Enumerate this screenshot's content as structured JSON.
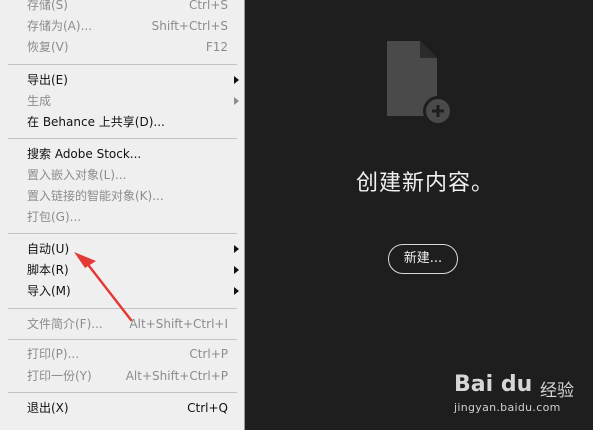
{
  "menu": {
    "items": [
      {
        "label": "存储(S)",
        "shortcut": "Ctrl+S",
        "disabled": true,
        "submenu": false
      },
      {
        "label": "存储为(A)...",
        "shortcut": "Shift+Ctrl+S",
        "disabled": true,
        "submenu": false
      },
      {
        "label": "恢复(V)",
        "shortcut": "F12",
        "disabled": true,
        "submenu": false
      },
      {
        "label": "导出(E)",
        "shortcut": "",
        "disabled": false,
        "submenu": true
      },
      {
        "label": "生成",
        "shortcut": "",
        "disabled": true,
        "submenu": true
      },
      {
        "label": "在 Behance 上共享(D)...",
        "shortcut": "",
        "disabled": false,
        "submenu": false
      },
      {
        "label": "搜索 Adobe Stock...",
        "shortcut": "",
        "disabled": false,
        "submenu": false
      },
      {
        "label": "置入嵌入对象(L)...",
        "shortcut": "",
        "disabled": true,
        "submenu": false
      },
      {
        "label": "置入链接的智能对象(K)...",
        "shortcut": "",
        "disabled": true,
        "submenu": false
      },
      {
        "label": "打包(G)...",
        "shortcut": "",
        "disabled": true,
        "submenu": false
      },
      {
        "label": "自动(U)",
        "shortcut": "",
        "disabled": false,
        "submenu": true
      },
      {
        "label": "脚本(R)",
        "shortcut": "",
        "disabled": false,
        "submenu": true
      },
      {
        "label": "导入(M)",
        "shortcut": "",
        "disabled": false,
        "submenu": true
      },
      {
        "label": "文件简介(F)...",
        "shortcut": "Alt+Shift+Ctrl+I",
        "disabled": true,
        "submenu": false
      },
      {
        "label": "打印(P)...",
        "shortcut": "Ctrl+P",
        "disabled": true,
        "submenu": false
      },
      {
        "label": "打印一份(Y)",
        "shortcut": "Alt+Shift+Ctrl+P",
        "disabled": true,
        "submenu": false
      },
      {
        "label": "退出(X)",
        "shortcut": "Ctrl+Q",
        "disabled": false,
        "submenu": false
      }
    ]
  },
  "welcome": {
    "title": "创建新内容。",
    "new_button": "新建...",
    "icon": "new-document-plus-icon"
  },
  "annotation": {
    "color": "#e53935",
    "target": "自动(U)"
  },
  "watermark": {
    "brand": "Bai du",
    "product": "经验",
    "url": "jingyan.baidu.com"
  },
  "colors": {
    "menu_bg": "#efefef",
    "app_bg": "#1e1e1e",
    "disabled_text": "#8c8c8c"
  }
}
